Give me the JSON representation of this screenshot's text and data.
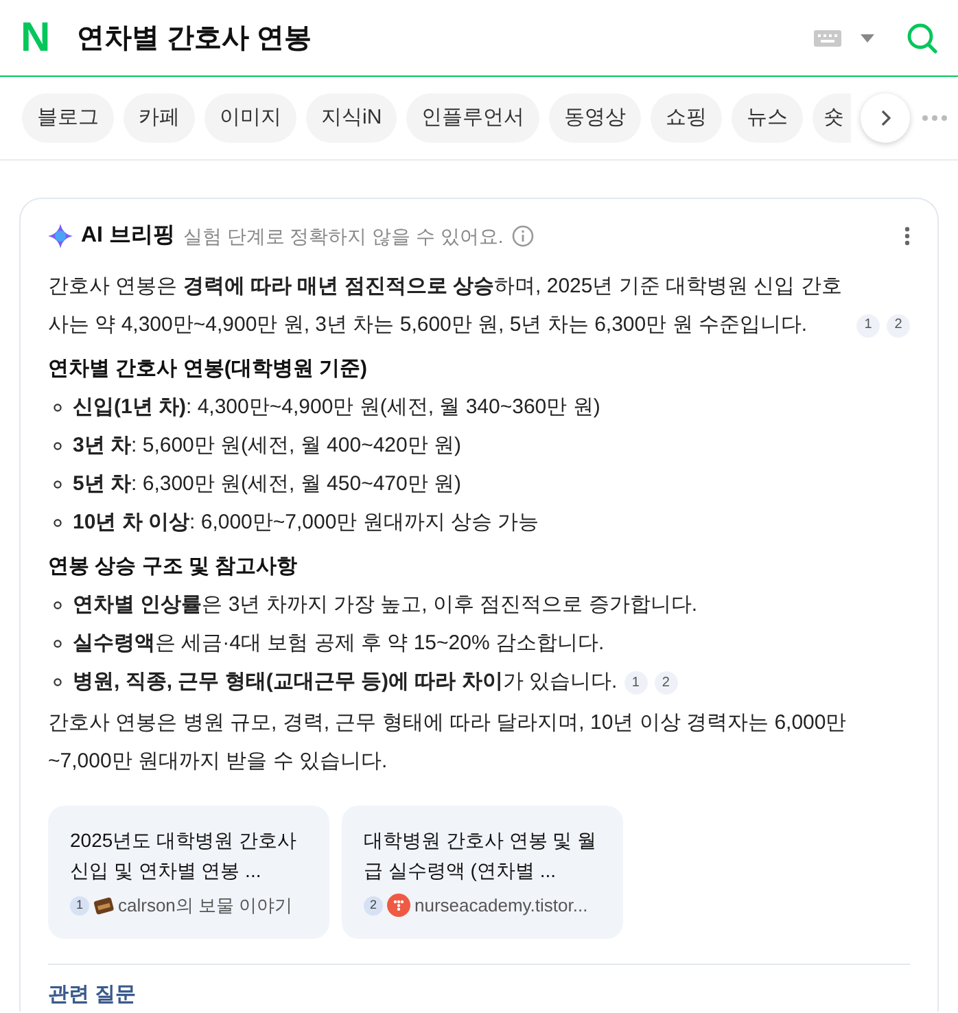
{
  "header": {
    "logo": "N",
    "query": "연차별 간호사 연봉"
  },
  "tabs": [
    {
      "label": "블로그"
    },
    {
      "label": "카페"
    },
    {
      "label": "이미지"
    },
    {
      "label": "지식iN"
    },
    {
      "label": "인플루언서"
    },
    {
      "label": "동영상"
    },
    {
      "label": "쇼핑"
    },
    {
      "label": "뉴스"
    },
    {
      "label": "숏"
    }
  ],
  "briefing": {
    "title": "AI 브리핑",
    "disclaimer": "실험 단계로 정확하지 않을 수 있어요.",
    "blocks": [
      {
        "kind": "paragraph",
        "text": "간호사 연봉은 **경력에 따라 매년 점진적으로 상승**하며, 2025년 기준 대학병원 신입 간호사는 약 4,300만~4,900만 원, 3년 차는 5,600만 원, 5년 차는 6,300만 원 수준입니다.",
        "citations": [
          "1",
          "2"
        ]
      },
      {
        "kind": "heading",
        "text": "연차별 간호사 연봉(대학병원 기준)"
      },
      {
        "kind": "bullet",
        "text": "**신입(1년 차)**: 4,300만~4,900만 원(세전, 월 340~360만 원)"
      },
      {
        "kind": "bullet",
        "text": "**3년 차**: 5,600만 원(세전, 월 400~420만 원)"
      },
      {
        "kind": "bullet",
        "text": "**5년 차**: 6,300만 원(세전, 월 450~470만 원)"
      },
      {
        "kind": "bullet",
        "text": "**10년 차 이상**: 6,000만~7,000만 원대까지 상승 가능"
      },
      {
        "kind": "heading",
        "text": "연봉 상승 구조 및 참고사항"
      },
      {
        "kind": "bullet",
        "text": "**연차별 인상률**은 3년 차까지 가장 높고, 이후 점진적으로 증가합니다."
      },
      {
        "kind": "bullet",
        "text": "**실수령액**은 세금·4대 보험 공제 후 약 15~20% 감소합니다."
      },
      {
        "kind": "bullet",
        "text": "**병원, 직종, 근무 형태(교대근무 등)에 따라 차이**가 있습니다.",
        "citations": [
          "1",
          "2"
        ]
      },
      {
        "kind": "paragraph",
        "text": "간호사 연봉은 병원 규모, 경력, 근무 형태에 따라 달라지며, 10년 이상 경력자는 6,000만~7,000만 원대까지 받을 수 있습니다."
      }
    ],
    "sources": [
      {
        "title": "2025년도 대학병원 간호사 신입 및 연차별 연봉 ...",
        "index": "1",
        "source": "calrson의 보물 이야기",
        "kind": "book"
      },
      {
        "title": "대학병원 간호사 연봉 및 월급 실수령액 (연차별 ...",
        "index": "2",
        "source": "nurseacademy.tistor...",
        "kind": "blog"
      }
    ],
    "related_title": "관련 질문"
  }
}
